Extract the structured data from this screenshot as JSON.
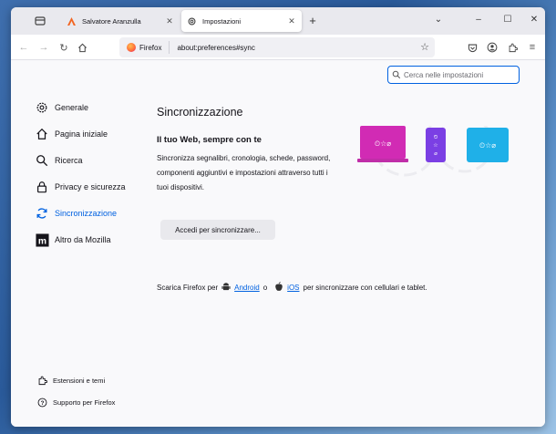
{
  "tabs": [
    {
      "label": "Salvatore Aranzulla",
      "active": false
    },
    {
      "label": "Impostazioni",
      "active": true
    }
  ],
  "address": {
    "brand": "Firefox",
    "url": "about:preferences#sync"
  },
  "search": {
    "placeholder": "Cerca nelle impostazioni"
  },
  "sidebar": {
    "items": [
      {
        "label": "Generale",
        "icon": "gear-icon"
      },
      {
        "label": "Pagina iniziale",
        "icon": "home-icon"
      },
      {
        "label": "Ricerca",
        "icon": "search-icon"
      },
      {
        "label": "Privacy e sicurezza",
        "icon": "lock-icon"
      },
      {
        "label": "Sincronizzazione",
        "icon": "sync-icon",
        "active": true
      },
      {
        "label": "Altro da Mozilla",
        "icon": "mozilla-icon"
      }
    ],
    "footer": [
      {
        "label": "Estensioni e temi",
        "icon": "puzzle-icon"
      },
      {
        "label": "Supporto per Firefox",
        "icon": "help-icon"
      }
    ]
  },
  "main": {
    "title": "Sincronizzazione",
    "subtitle": "Il tuo Web, sempre con te",
    "description": "Sincronizza segnalibri, cronologia, schede, password, componenti aggiuntivi e impostazioni attraverso tutti i tuoi dispositivi.",
    "signin_button": "Accedi per sincronizzare...",
    "download": {
      "prefix": "Scarica Firefox per",
      "android": "Android",
      "or": "o",
      "ios": "iOS",
      "suffix": "per sincronizzare con cellulari e tablet."
    }
  },
  "colors": {
    "accent": "#0061e0",
    "laptop": "#d12bb4",
    "phone": "#7b3fe4",
    "tablet": "#1fb0e8"
  }
}
